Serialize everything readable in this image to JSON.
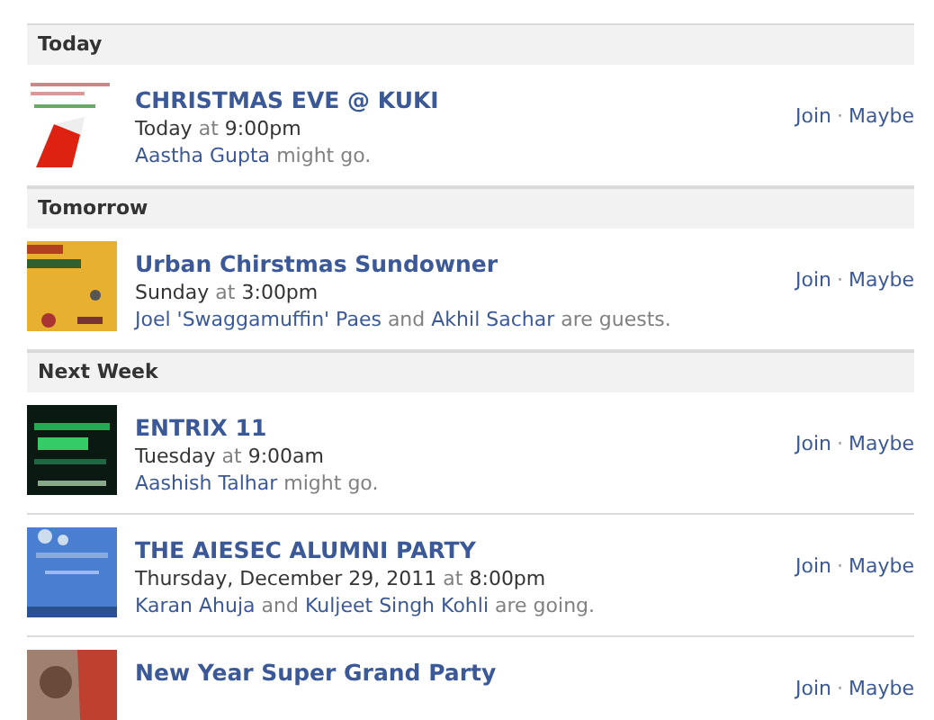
{
  "sections": [
    {
      "heading": "Today",
      "events": [
        {
          "title": "CHRISTMAS EVE @ KUKI",
          "day": "Today",
          "joiner": "at",
          "time": "9:00pm",
          "people": [
            {
              "text": "Aastha Gupta",
              "kind": "link"
            },
            {
              "text": "might go.",
              "kind": "plain"
            }
          ],
          "actions": [
            "Join",
            "Maybe"
          ],
          "separator": "·"
        }
      ]
    },
    {
      "heading": "Tomorrow",
      "events": [
        {
          "title": "Urban Chirstmas Sundowner",
          "day": "Sunday",
          "joiner": "at",
          "time": "3:00pm",
          "people": [
            {
              "text": "Joel 'Swaggamuffin' Paes",
              "kind": "link"
            },
            {
              "text": "and",
              "kind": "plain"
            },
            {
              "text": "Akhil Sachar",
              "kind": "link"
            },
            {
              "text": "are guests.",
              "kind": "plain"
            }
          ],
          "actions": [
            "Join",
            "Maybe"
          ],
          "separator": "·"
        }
      ]
    },
    {
      "heading": "Next Week",
      "events": [
        {
          "title": "ENTRIX 11",
          "day": "Tuesday",
          "joiner": "at",
          "time": "9:00am",
          "people": [
            {
              "text": "Aashish Talhar",
              "kind": "link"
            },
            {
              "text": "might go.",
              "kind": "plain"
            }
          ],
          "actions": [
            "Join",
            "Maybe"
          ],
          "separator": "·"
        },
        {
          "title": "THE AIESEC ALUMNI PARTY",
          "day": "Thursday, December 29, 2011",
          "joiner": "at",
          "time": "8:00pm",
          "people": [
            {
              "text": "Karan Ahuja",
              "kind": "link"
            },
            {
              "text": "and",
              "kind": "plain"
            },
            {
              "text": "Kuljeet Singh Kohli",
              "kind": "link"
            },
            {
              "text": "are going.",
              "kind": "plain"
            }
          ],
          "actions": [
            "Join",
            "Maybe"
          ],
          "separator": "·"
        },
        {
          "title": "New Year Super Grand Party",
          "actions": [
            "Join",
            "Maybe"
          ],
          "separator": "·"
        }
      ]
    }
  ]
}
